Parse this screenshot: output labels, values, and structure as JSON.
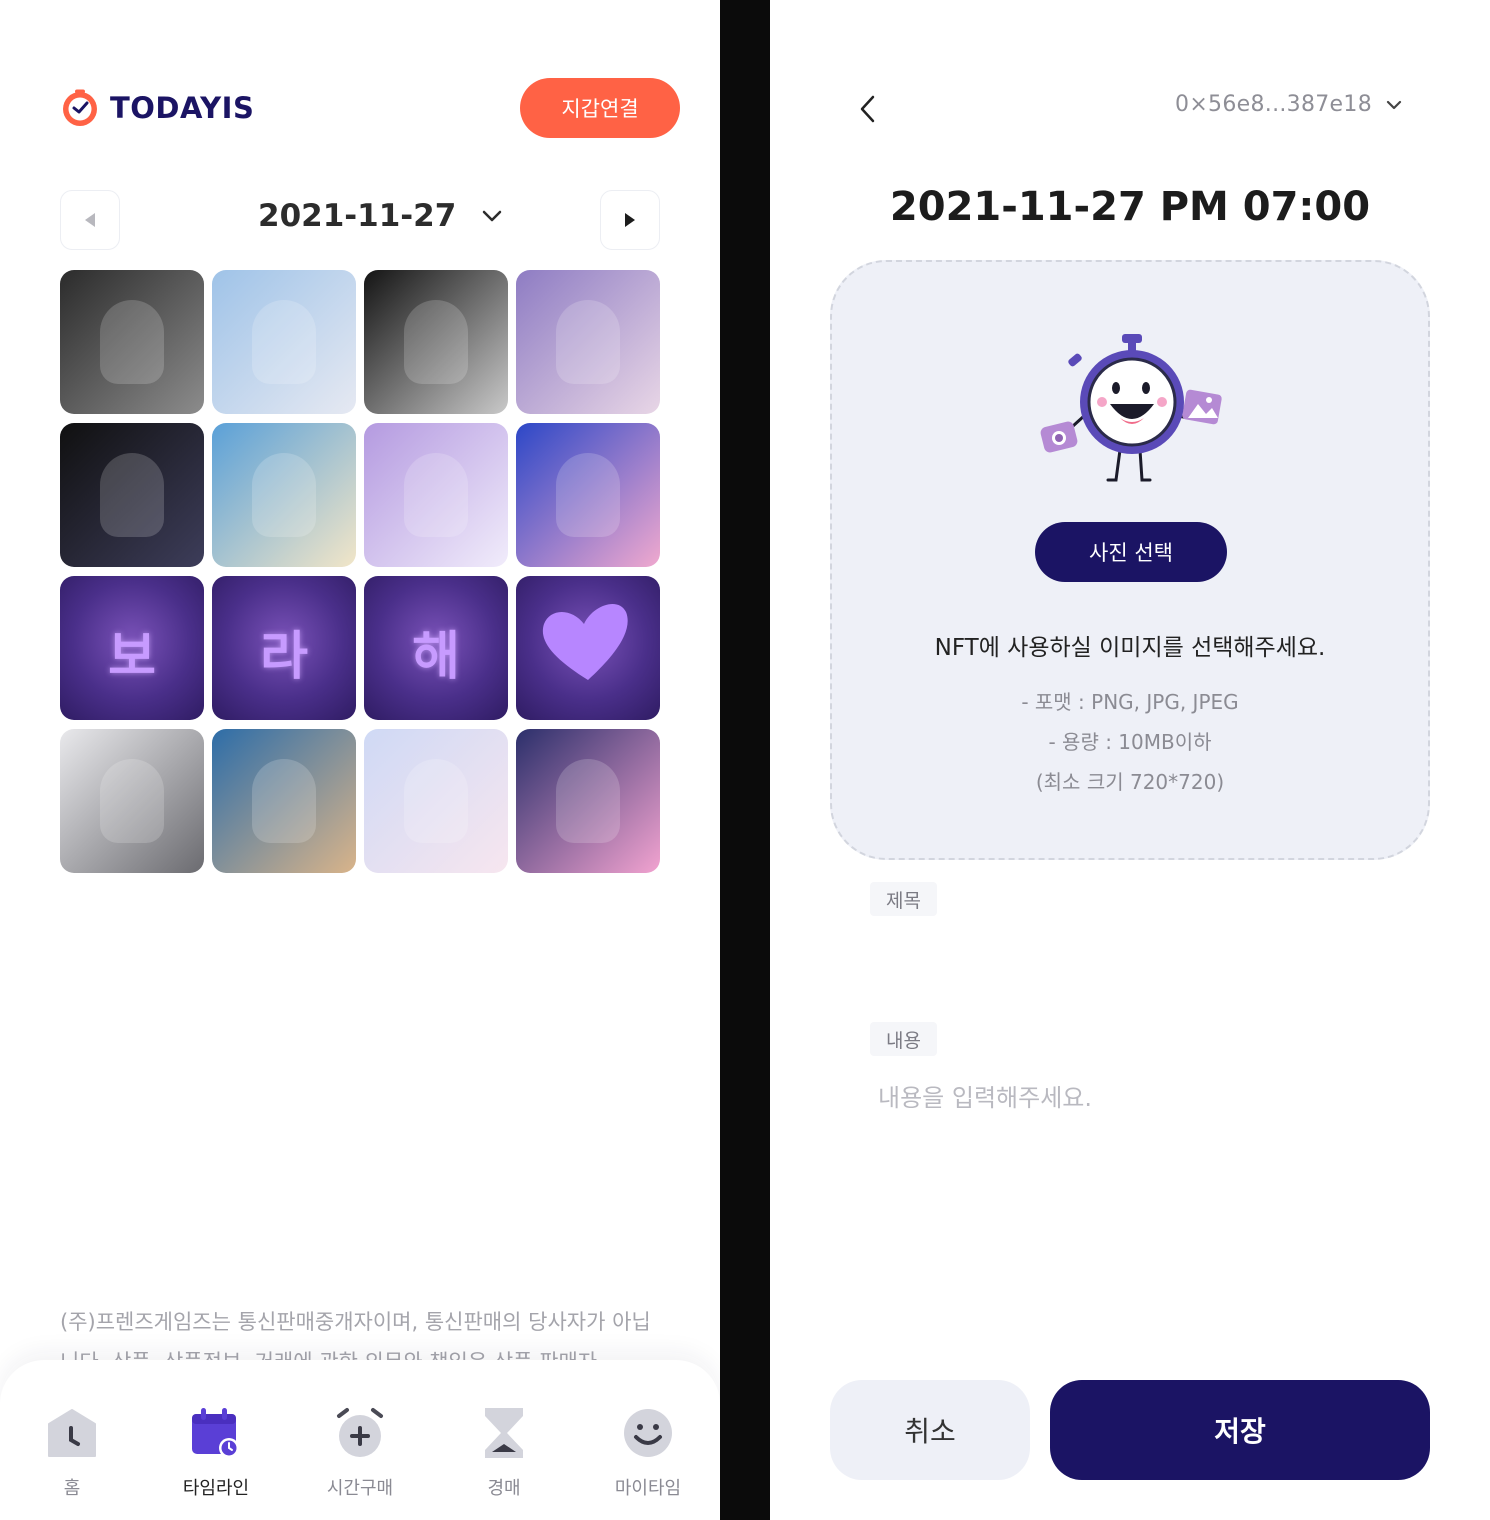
{
  "brand": {
    "name": "TODAYIS",
    "accent": "#ff6245",
    "navy": "#1b1464"
  },
  "left": {
    "wallet_button": "지갑연결",
    "date": "2021-11-27",
    "grid_tiles": [
      {
        "kind": "photo"
      },
      {
        "kind": "photo"
      },
      {
        "kind": "photo"
      },
      {
        "kind": "photo"
      },
      {
        "kind": "photo"
      },
      {
        "kind": "photo"
      },
      {
        "kind": "photo"
      },
      {
        "kind": "photo"
      },
      {
        "kind": "text",
        "text": "보"
      },
      {
        "kind": "text",
        "text": "라"
      },
      {
        "kind": "text",
        "text": "해"
      },
      {
        "kind": "heart"
      },
      {
        "kind": "photo"
      },
      {
        "kind": "photo"
      },
      {
        "kind": "photo"
      },
      {
        "kind": "photo"
      }
    ],
    "footer": "(주)프렌즈게임즈는 통신판매중개자이며, 통신판매의 당사자가 아닙니다. 상품, 상품정보, 거래에 관한 의무와 책임은 상품 판매자",
    "tabs": [
      {
        "label": "홈",
        "icon": "home-clock-icon"
      },
      {
        "label": "타임라인",
        "icon": "calendar-clock-icon",
        "active": true
      },
      {
        "label": "시간구매",
        "icon": "alarm-plus-icon"
      },
      {
        "label": "경매",
        "icon": "hourglass-icon"
      },
      {
        "label": "마이타임",
        "icon": "smiley-icon"
      }
    ]
  },
  "right": {
    "wallet_address": "0×56e8...387e18",
    "datetime": "2021-11-27 PM 07:00",
    "photo_button": "사진 선택",
    "upload_title": "NFT에 사용하실 이미지를 선택해주세요.",
    "spec_format": "- 포맷 : PNG, JPG, JPEG",
    "spec_size": "- 용량 : 10MB이하",
    "spec_min": "(최소 크기 720*720)",
    "title_label": "제목",
    "content_label": "내용",
    "content_placeholder": "내용을 입력해주세요.",
    "cancel_button": "취소",
    "save_button": "저장"
  }
}
